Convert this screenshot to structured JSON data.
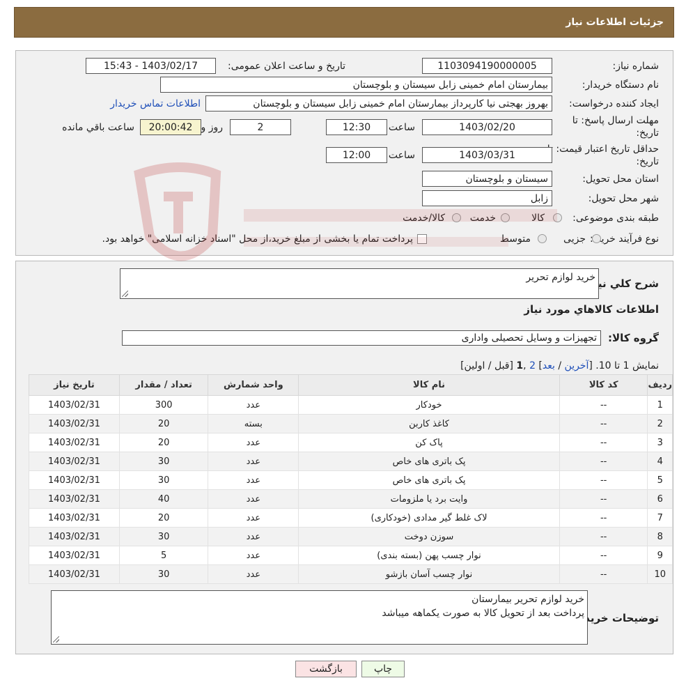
{
  "header": {
    "title": "جزئیات اطلاعات نیاز"
  },
  "form": {
    "need_number_label": "شماره نیاز:",
    "need_number": "1103094190000005",
    "announce_label": "تاریخ و ساعت اعلان عمومی:",
    "announce_value": "1403/02/17 - 15:43",
    "buyer_org_label": "نام دستگاه خریدار:",
    "buyer_org": "بیمارستان امام خمینی زابل سیستان و بلوچستان",
    "creator_label": "ایجاد کننده درخواست:",
    "creator": "بهروز بهجتی نیا کارپرداز بیمارستان امام خمینی زابل سیستان و بلوچستان",
    "contact_link": "اطلاعات تماس خریدار",
    "reply_deadline_label_line1": "مهلت ارسال پاسخ: تا",
    "reply_deadline_label_line2": "تاریخ:",
    "reply_date": "1403/02/20",
    "time_label": "ساعت",
    "reply_time": "12:30",
    "days": "2",
    "days_label": "روز و",
    "remaining_time": "20:00:42",
    "remaining_label": "ساعت باقي مانده",
    "price_valid_label_line1": "حداقل تاریخ اعتبار قیمت: تا",
    "price_valid_label_line2": "تاریخ:",
    "price_valid_date": "1403/03/31",
    "price_valid_time": "12:00",
    "province_label": "استان محل تحویل:",
    "province": "سیستان و بلوچستان",
    "city_label": "شهر محل تحویل:",
    "city": "زابل",
    "category_label": "طبقه بندی موضوعی:",
    "category_options": [
      "کالا",
      "خدمت",
      "کالا/خدمت"
    ],
    "process_label": "نوع فرآیند خرید :",
    "process_options": [
      "جزیی",
      "متوسط"
    ],
    "payment_note": "پرداخت تمام یا بخشی از مبلغ خرید،از محل \"اسناد خزانه اسلامی\" خواهد بود."
  },
  "details": {
    "general_desc_label": "شرح كلي نياز:",
    "general_desc": "خرید لوازم تحریر",
    "items_info_title": "اطلاعات كالاهاي مورد نياز",
    "goods_group_label": "گروه كالا:",
    "goods_group": "تجهیزات و وسایل تحصیلی واداری",
    "pagination": {
      "prefix": "نمایش 1 تا 10. [",
      "last": "آخرین",
      "sep1": " / ",
      "next": "بعد",
      "sep2": "] ",
      "page2": "2",
      "comma": " ,",
      "page1": "1",
      "suffix": " [قبل / اولین]"
    },
    "table": {
      "headers": [
        "ردیف",
        "کد کالا",
        "نام کالا",
        "واحد شمارش",
        "تعداد / مقدار",
        "تاریخ نیاز"
      ],
      "rows": [
        [
          "1",
          "--",
          "خودکار",
          "عدد",
          "300",
          "1403/02/31"
        ],
        [
          "2",
          "--",
          "کاغذ کاربن",
          "بسته",
          "20",
          "1403/02/31"
        ],
        [
          "3",
          "--",
          "پاک کن",
          "عدد",
          "20",
          "1403/02/31"
        ],
        [
          "4",
          "--",
          "پک باتری های خاص",
          "عدد",
          "30",
          "1403/02/31"
        ],
        [
          "5",
          "--",
          "پک باتری های خاص",
          "عدد",
          "30",
          "1403/02/31"
        ],
        [
          "6",
          "--",
          "وایت برد یا ملزومات",
          "عدد",
          "40",
          "1403/02/31"
        ],
        [
          "7",
          "--",
          "لاک غلط گیر مدادی (خودکاری)",
          "عدد",
          "20",
          "1403/02/31"
        ],
        [
          "8",
          "--",
          "سوزن دوخت",
          "عدد",
          "30",
          "1403/02/31"
        ],
        [
          "9",
          "--",
          "نوار چسب پهن (بسته بندی)",
          "عدد",
          "5",
          "1403/02/31"
        ],
        [
          "10",
          "--",
          "نوار چسب آسان بازشو",
          "عدد",
          "30",
          "1403/02/31"
        ]
      ]
    },
    "buyer_notes_label": "توضیحات خریدار:",
    "buyer_notes_line1": "خرید لوازم تحریر بیمارستان",
    "buyer_notes_line2": "پرداخت بعد از تحویل کالا به صورت یکماهه میباشد"
  },
  "buttons": {
    "print": "چاپ",
    "back": "بازگشت"
  },
  "colors": {
    "header_bg": "#8b6c40",
    "link": "#1f4fb8",
    "back_btn": "#fbe3e4",
    "print_btn": "#eefbe6"
  }
}
